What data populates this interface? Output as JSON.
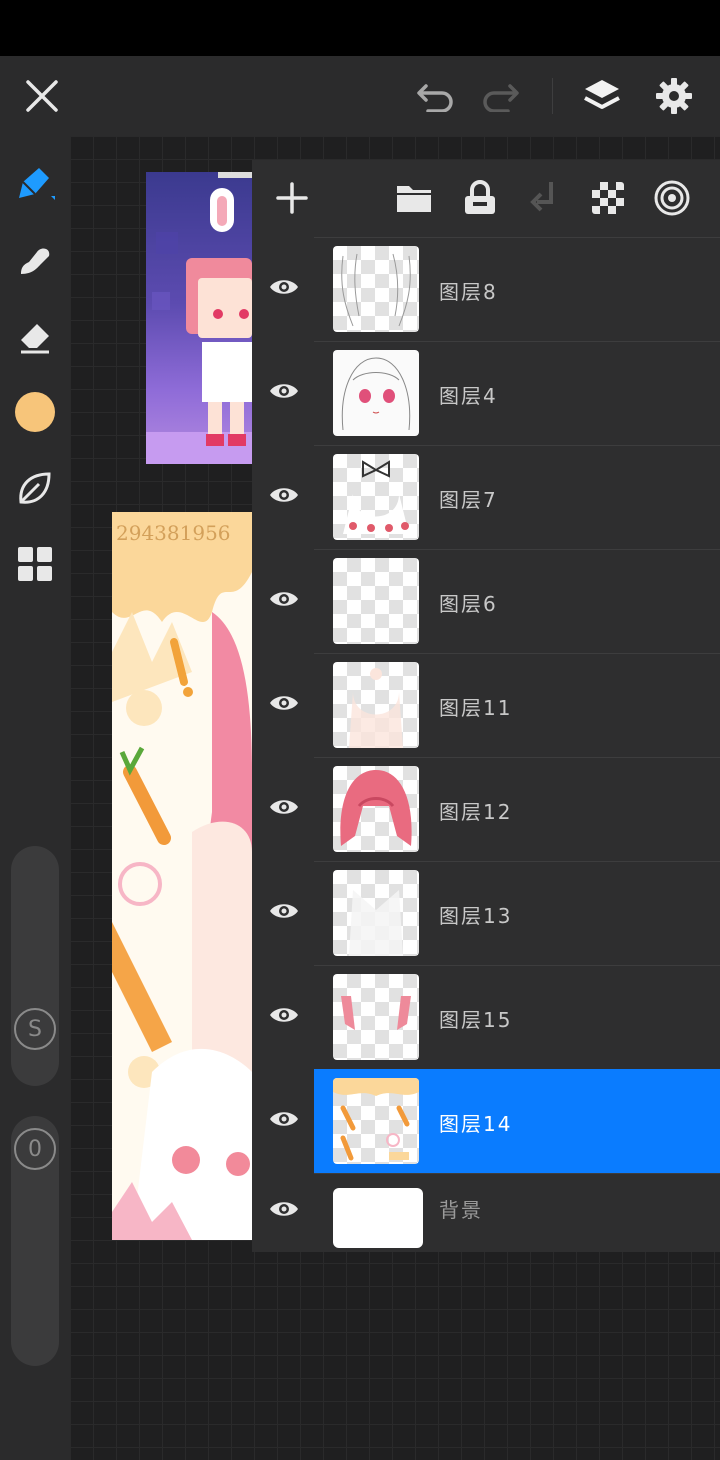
{
  "topbar": {
    "icons": [
      "close-icon",
      "undo-icon",
      "redo-icon",
      "layers-icon",
      "settings-icon"
    ]
  },
  "left_toolbar": {
    "tools": [
      "pen-tool-icon",
      "smudge-tool-icon",
      "eraser-tool-icon",
      "color-swatch",
      "leaf-brush-icon",
      "grid-tool-icon"
    ],
    "color": "#f7c57a",
    "size_badge": "S",
    "opacity_badge": "0"
  },
  "colors": {
    "accent": "#0a7cff",
    "panel_bg": "#2e2e2f",
    "toolbar_bg": "#2b2b2c"
  },
  "artwork": {
    "watermark_text": "294381956"
  },
  "layers_panel": {
    "toolbar_icons": [
      "add-layer-icon",
      "folder-icon",
      "lock-icon",
      "merge-down-icon",
      "transparency-icon",
      "target-icon"
    ],
    "layers": [
      {
        "name": "图层8",
        "visible": true,
        "selected": false
      },
      {
        "name": "图层4",
        "visible": true,
        "selected": false
      },
      {
        "name": "图层7",
        "visible": true,
        "selected": false
      },
      {
        "name": "图层6",
        "visible": true,
        "selected": false
      },
      {
        "name": "图层11",
        "visible": true,
        "selected": false
      },
      {
        "name": "图层12",
        "visible": true,
        "selected": false
      },
      {
        "name": "图层13",
        "visible": true,
        "selected": false
      },
      {
        "name": "图层15",
        "visible": true,
        "selected": false
      },
      {
        "name": "图层14",
        "visible": true,
        "selected": true
      }
    ],
    "background_layer": {
      "name": "背景",
      "visible": true
    }
  }
}
